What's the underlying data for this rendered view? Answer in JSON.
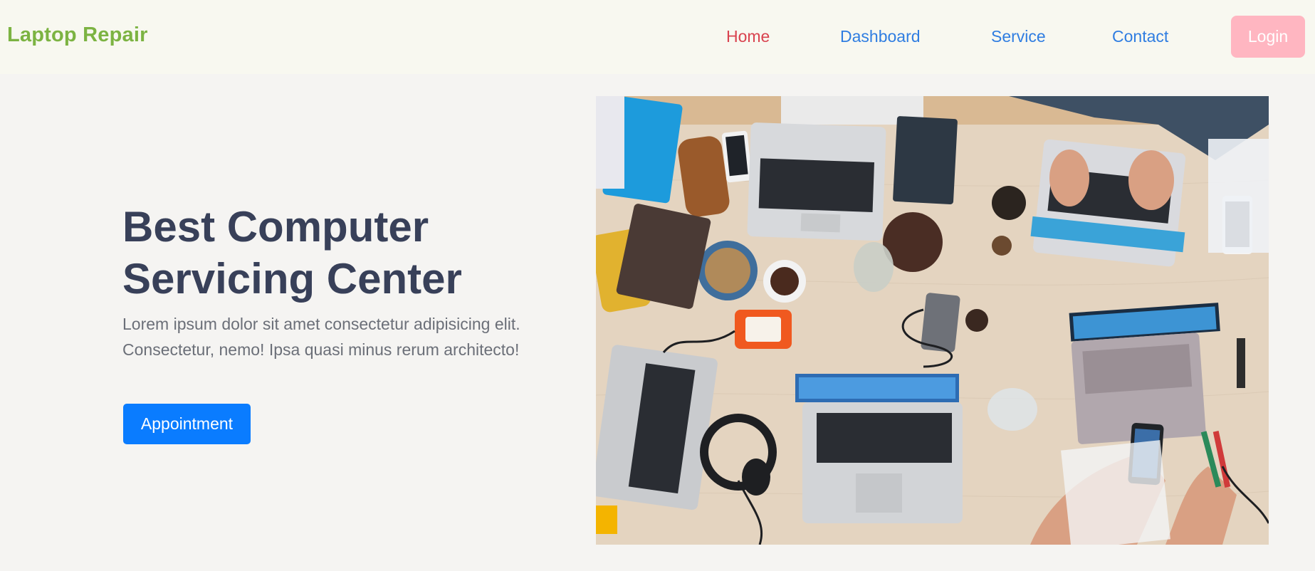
{
  "nav": {
    "brand": "Laptop Repair",
    "links": [
      "Home",
      "Dashboard",
      "Service",
      "Contact"
    ],
    "active_link": "Home",
    "login_label": "Login"
  },
  "hero": {
    "title": "Best Computer Servicing Center",
    "description": "Lorem ipsum dolor sit amet consectetur adipisicing elit. Consectetur, nemo! Ipsa quasi minus rerum architecto!",
    "button_label": "Appointment",
    "image_icon": "laptops-on-desk-photo"
  },
  "colors": {
    "brand": "#7cb342",
    "active_link": "#d9434f",
    "link": "#2f7de1",
    "login_button": "#ffb6c1",
    "primary_button": "#0a7cff",
    "heading": "#384059",
    "body_text": "#6b6f78"
  }
}
